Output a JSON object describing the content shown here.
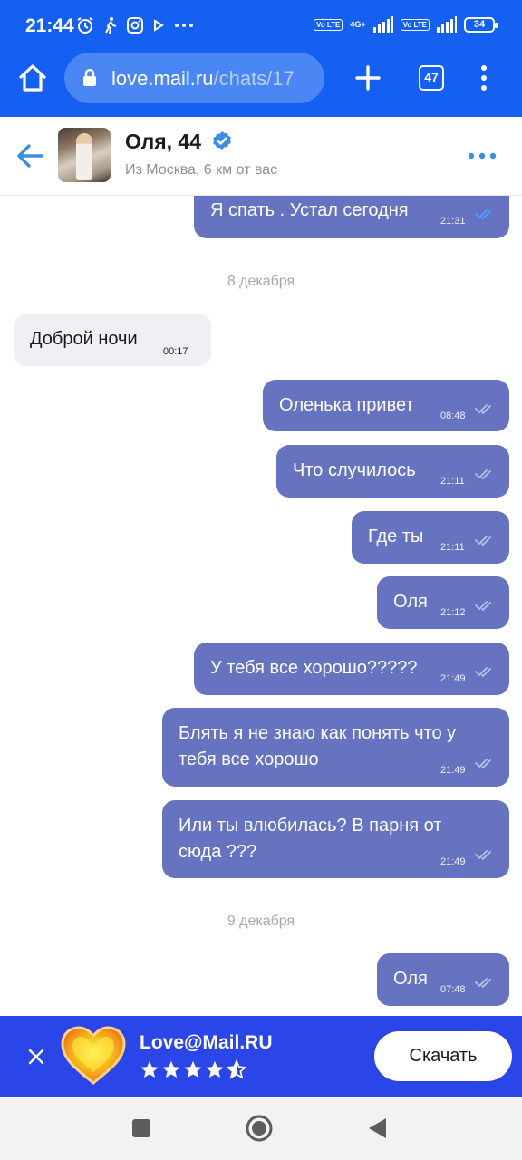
{
  "statusbar": {
    "time": "21:44",
    "network_4g": "4G+",
    "volte_1": "Vo LTE",
    "volte_2": "Vo LTE",
    "battery": "34"
  },
  "browser": {
    "url_domain": "love.mail.ru",
    "url_path": "/chats/17",
    "tab_count": "47",
    "icons": [
      "home-icon",
      "lock-icon",
      "plus-icon",
      "tabs-icon",
      "menu-icon"
    ]
  },
  "chat": {
    "name": "Оля, 44",
    "subtitle": "Из Москва, 6 км от вас"
  },
  "messages": [
    {
      "dir": "out",
      "text": "Я спать . Устал сегодня",
      "time": "21:31",
      "read": true
    },
    {
      "date": "8 декабря"
    },
    {
      "dir": "in",
      "text": "Доброй ночи",
      "time": "00:17"
    },
    {
      "dir": "out",
      "text": "Оленька привет",
      "time": "08:48",
      "read": false
    },
    {
      "dir": "out",
      "text": "Что случилось",
      "time": "21:11",
      "read": false
    },
    {
      "dir": "out",
      "text": "Где ты",
      "time": "21:11",
      "read": false
    },
    {
      "dir": "out",
      "text": "Оля",
      "time": "21:12",
      "read": false
    },
    {
      "dir": "out",
      "text": "У тебя все хорошо?????",
      "time": "21:49",
      "read": false
    },
    {
      "dir": "out",
      "text": "Блять я не знаю как понять что у",
      "text2": "тебя все хорошо",
      "time": "21:49",
      "read": false
    },
    {
      "dir": "out",
      "text": "Или ты влюбилась? В парня от",
      "text2": "сюда ???",
      "time": "21:49",
      "read": false
    },
    {
      "date": "9 декабря"
    },
    {
      "dir": "out",
      "text": "Оля",
      "time": "07:48",
      "read": false
    }
  ],
  "colors": {
    "brand_blue": "#1560f1",
    "bubble_out": "#6573c0",
    "bubble_in": "#eef0f4",
    "check_read": "#4aa3ff",
    "check_unread": "#b8bfe6",
    "ad_bg": "#2a45e8"
  },
  "ad": {
    "title": "Love@Mail.RU",
    "rating": 4.5,
    "button_label": "Скачать"
  }
}
